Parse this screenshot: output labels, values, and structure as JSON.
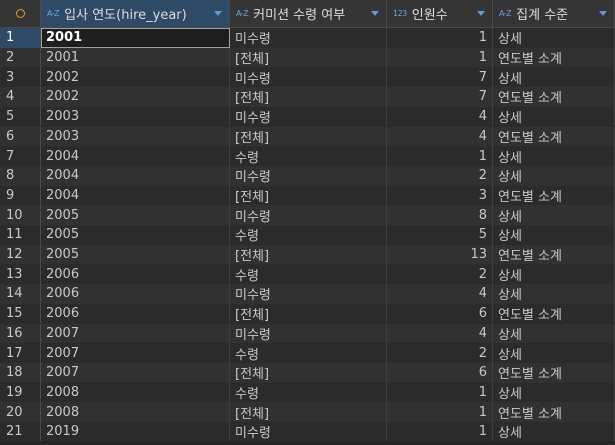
{
  "columns": [
    {
      "type_icon": "A-Z",
      "label": "입사 연도(hire_year)"
    },
    {
      "type_icon": "A-Z",
      "label": "커미션 수령 여부"
    },
    {
      "type_icon": "123",
      "label": "인원수"
    },
    {
      "type_icon": "A-Z",
      "label": "집계 수준"
    }
  ],
  "rows": [
    {
      "n": "1",
      "year": "2001",
      "comm": "미수령",
      "count": "1",
      "level": "상세"
    },
    {
      "n": "2",
      "year": "2001",
      "comm": "[전체]",
      "count": "1",
      "level": "연도별 소계"
    },
    {
      "n": "3",
      "year": "2002",
      "comm": "미수령",
      "count": "7",
      "level": "상세"
    },
    {
      "n": "4",
      "year": "2002",
      "comm": "[전체]",
      "count": "7",
      "level": "연도별 소계"
    },
    {
      "n": "5",
      "year": "2003",
      "comm": "미수령",
      "count": "4",
      "level": "상세"
    },
    {
      "n": "6",
      "year": "2003",
      "comm": "[전체]",
      "count": "4",
      "level": "연도별 소계"
    },
    {
      "n": "7",
      "year": "2004",
      "comm": "수령",
      "count": "1",
      "level": "상세"
    },
    {
      "n": "8",
      "year": "2004",
      "comm": "미수령",
      "count": "2",
      "level": "상세"
    },
    {
      "n": "9",
      "year": "2004",
      "comm": "[전체]",
      "count": "3",
      "level": "연도별 소계"
    },
    {
      "n": "10",
      "year": "2005",
      "comm": "미수령",
      "count": "8",
      "level": "상세"
    },
    {
      "n": "11",
      "year": "2005",
      "comm": "수령",
      "count": "5",
      "level": "상세"
    },
    {
      "n": "12",
      "year": "2005",
      "comm": "[전체]",
      "count": "13",
      "level": "연도별 소계"
    },
    {
      "n": "13",
      "year": "2006",
      "comm": "수령",
      "count": "2",
      "level": "상세"
    },
    {
      "n": "14",
      "year": "2006",
      "comm": "미수령",
      "count": "4",
      "level": "상세"
    },
    {
      "n": "15",
      "year": "2006",
      "comm": "[전체]",
      "count": "6",
      "level": "연도별 소계"
    },
    {
      "n": "16",
      "year": "2007",
      "comm": "미수령",
      "count": "4",
      "level": "상세"
    },
    {
      "n": "17",
      "year": "2007",
      "comm": "수령",
      "count": "2",
      "level": "상세"
    },
    {
      "n": "18",
      "year": "2007",
      "comm": "[전체]",
      "count": "6",
      "level": "연도별 소계"
    },
    {
      "n": "19",
      "year": "2008",
      "comm": "수령",
      "count": "1",
      "level": "상세"
    },
    {
      "n": "20",
      "year": "2008",
      "comm": "[전체]",
      "count": "1",
      "level": "연도별 소계"
    },
    {
      "n": "21",
      "year": "2019",
      "comm": "미수령",
      "count": "1",
      "level": "상세"
    }
  ]
}
